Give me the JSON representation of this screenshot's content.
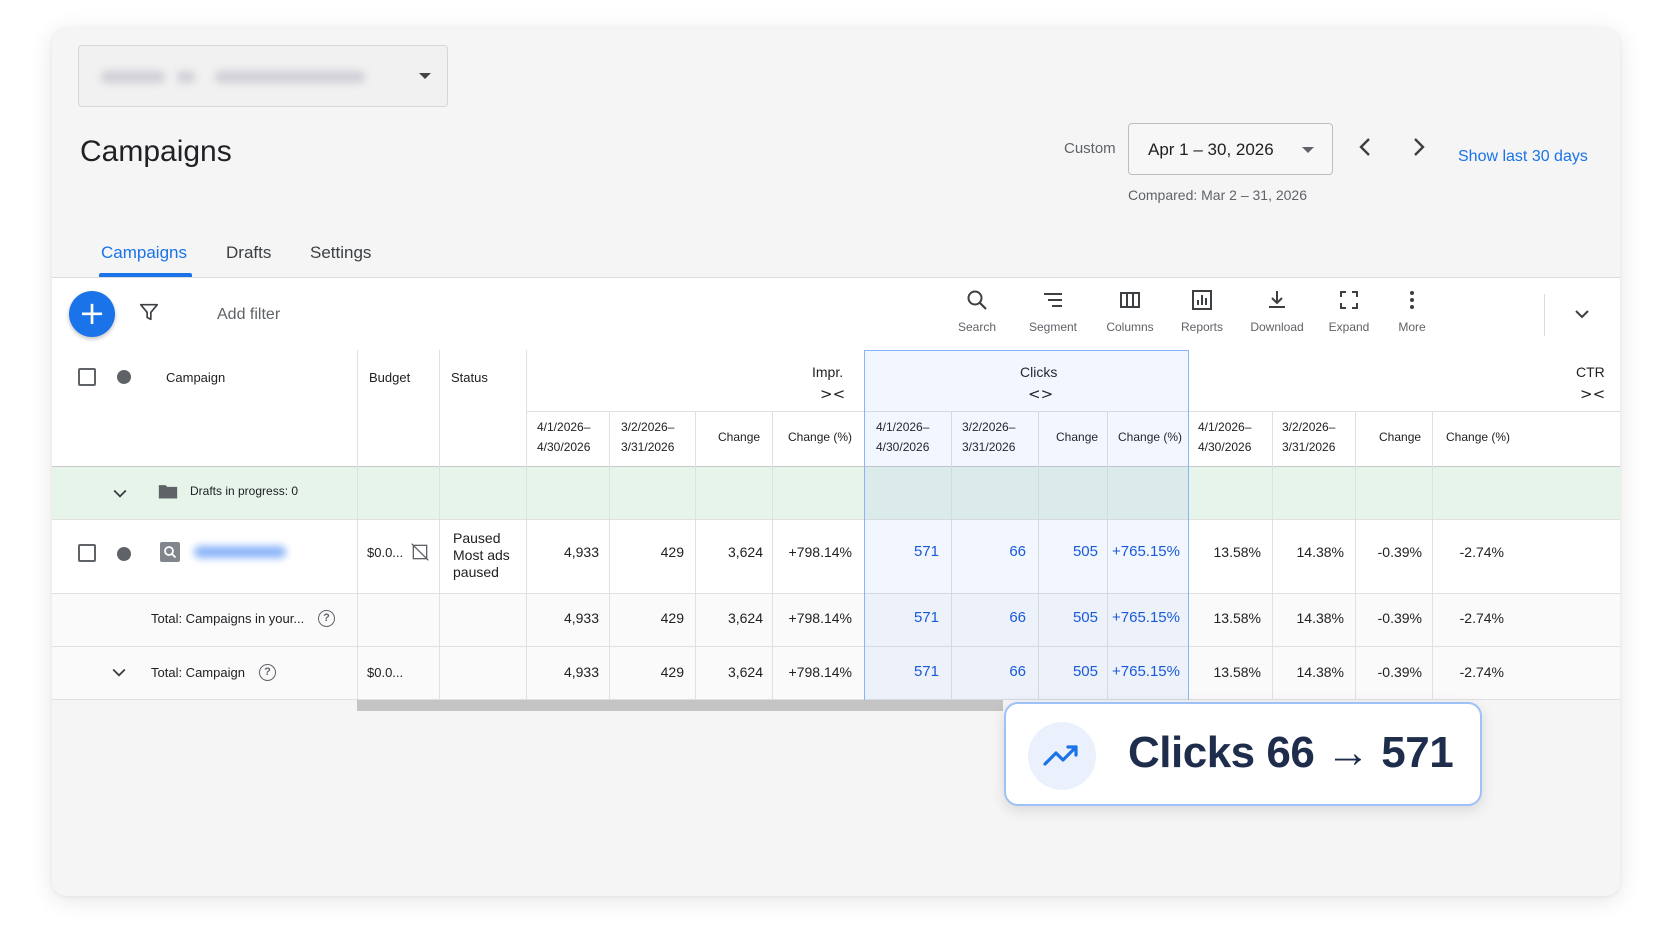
{
  "account_selector": {
    "label": ""
  },
  "page": {
    "title": "Campaigns"
  },
  "date_range": {
    "custom_label": "Custom",
    "value": "Apr 1 – 30, 2026",
    "prev_arrow": "‹",
    "next_arrow": "›",
    "show_last": "Show last 30 days",
    "compared": "Compared: Mar 2 – 31, 2026"
  },
  "tabs": [
    {
      "label": "Campaigns",
      "active": true
    },
    {
      "label": "Drafts",
      "active": false
    },
    {
      "label": "Settings",
      "active": false
    }
  ],
  "toolbar": {
    "add_icon": "+",
    "add_filter": "Add filter",
    "buttons": [
      {
        "label": "Search",
        "icon": "search-icon"
      },
      {
        "label": "Segment",
        "icon": "segment-icon"
      },
      {
        "label": "Columns",
        "icon": "columns-icon"
      },
      {
        "label": "Reports",
        "icon": "reports-icon"
      },
      {
        "label": "Download",
        "icon": "download-icon"
      },
      {
        "label": "Expand",
        "icon": "expand-icon"
      },
      {
        "label": "More",
        "icon": "more-icon"
      }
    ]
  },
  "table": {
    "headers": {
      "campaign": "Campaign",
      "budget": "Budget",
      "status": "Status",
      "impr": "Impr.",
      "clicks": "Clicks",
      "ctr": "CTR",
      "collapse_glyph": "><",
      "expand_glyph": "<>"
    },
    "sub_headers": {
      "current_a": "4/1/2026–",
      "current_b": "4/30/2026",
      "previous_a": "3/2/2026–",
      "previous_b": "3/31/2026",
      "change": "Change",
      "change_pct": "Change (%)"
    },
    "drafts_row": {
      "label": "Drafts in progress: 0"
    },
    "campaign_row": {
      "name": "",
      "budget": "$0.0...",
      "status_line1": "Paused",
      "status_line2": "Most ads",
      "status_line3": "paused",
      "impr": [
        "4,933",
        "429",
        "3,624",
        "+798.14%"
      ],
      "clicks": [
        "571",
        "66",
        "505",
        "+765.15%"
      ],
      "ctr": [
        "13.58%",
        "14.38%",
        "-0.39%",
        "-2.74%"
      ]
    },
    "total_your_row": {
      "label": "Total: Campaigns in your...",
      "impr": [
        "4,933",
        "429",
        "3,624",
        "+798.14%"
      ],
      "clicks": [
        "571",
        "66",
        "505",
        "+765.15%"
      ],
      "ctr": [
        "13.58%",
        "14.38%",
        "-0.39%",
        "-2.74%"
      ]
    },
    "total_campaign_row": {
      "label": "Total: Campaign",
      "budget": "$0.0...",
      "impr": [
        "4,933",
        "429",
        "3,624",
        "+798.14%"
      ],
      "clicks": [
        "571",
        "66",
        "505",
        "+765.15%"
      ],
      "ctr": [
        "13.58%",
        "14.38%",
        "-0.39%",
        "-2.74%"
      ]
    }
  },
  "callout": {
    "text": "Clicks 66 → 571"
  },
  "colors": {
    "accent": "#1a73e8",
    "highlight_text": "#1558d6",
    "drafts_bg": "#e6f4ea"
  }
}
